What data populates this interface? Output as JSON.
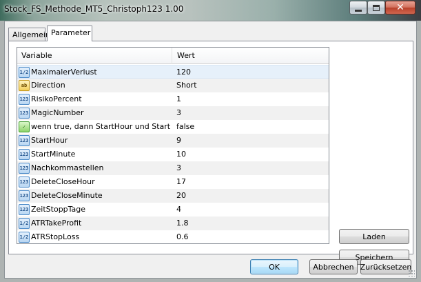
{
  "window": {
    "title": "Stock_FS_Methode_MT5_Christoph123 1.00",
    "close_glyph": "✕"
  },
  "tabs": [
    {
      "label": "Allgemein",
      "active": false
    },
    {
      "label": "Parameter",
      "active": true
    }
  ],
  "grid": {
    "headers": {
      "variable": "Variable",
      "value": "Wert"
    },
    "rows": [
      {
        "type_icon": "1/2",
        "icon": "double-icon",
        "name": "MaximalerVerlust",
        "value": "120"
      },
      {
        "type_icon": "ab",
        "icon": "string-icon",
        "name": "Direction",
        "value": "Short"
      },
      {
        "type_icon": "123",
        "icon": "integer-icon",
        "name": "RisikoPercent",
        "value": "1"
      },
      {
        "type_icon": "123",
        "icon": "integer-icon",
        "name": "MagicNumber",
        "value": "3"
      },
      {
        "type_icon": "✓",
        "icon": "bool-icon",
        "name": "wenn true, dann StartHour und StartMi...",
        "value": "false"
      },
      {
        "type_icon": "123",
        "icon": "integer-icon",
        "name": "StartHour",
        "value": "9"
      },
      {
        "type_icon": "123",
        "icon": "integer-icon",
        "name": "StartMinute",
        "value": "10"
      },
      {
        "type_icon": "123",
        "icon": "integer-icon",
        "name": "Nachkommastellen",
        "value": "3"
      },
      {
        "type_icon": "123",
        "icon": "integer-icon",
        "name": "DeleteCloseHour",
        "value": "17"
      },
      {
        "type_icon": "123",
        "icon": "integer-icon",
        "name": "DeleteCloseMinute",
        "value": "20"
      },
      {
        "type_icon": "123",
        "icon": "integer-icon",
        "name": "ZeitStoppTage",
        "value": "4"
      },
      {
        "type_icon": "1/2",
        "icon": "double-icon",
        "name": "ATRTakeProfit",
        "value": "1.8"
      },
      {
        "type_icon": "1/2",
        "icon": "double-icon",
        "name": "ATRStopLoss",
        "value": "0.6"
      }
    ]
  },
  "buttons": {
    "load": "Laden",
    "save": "Speichern",
    "ok": "OK",
    "cancel": "Abbrechen",
    "reset": "Zurücksetzen"
  }
}
